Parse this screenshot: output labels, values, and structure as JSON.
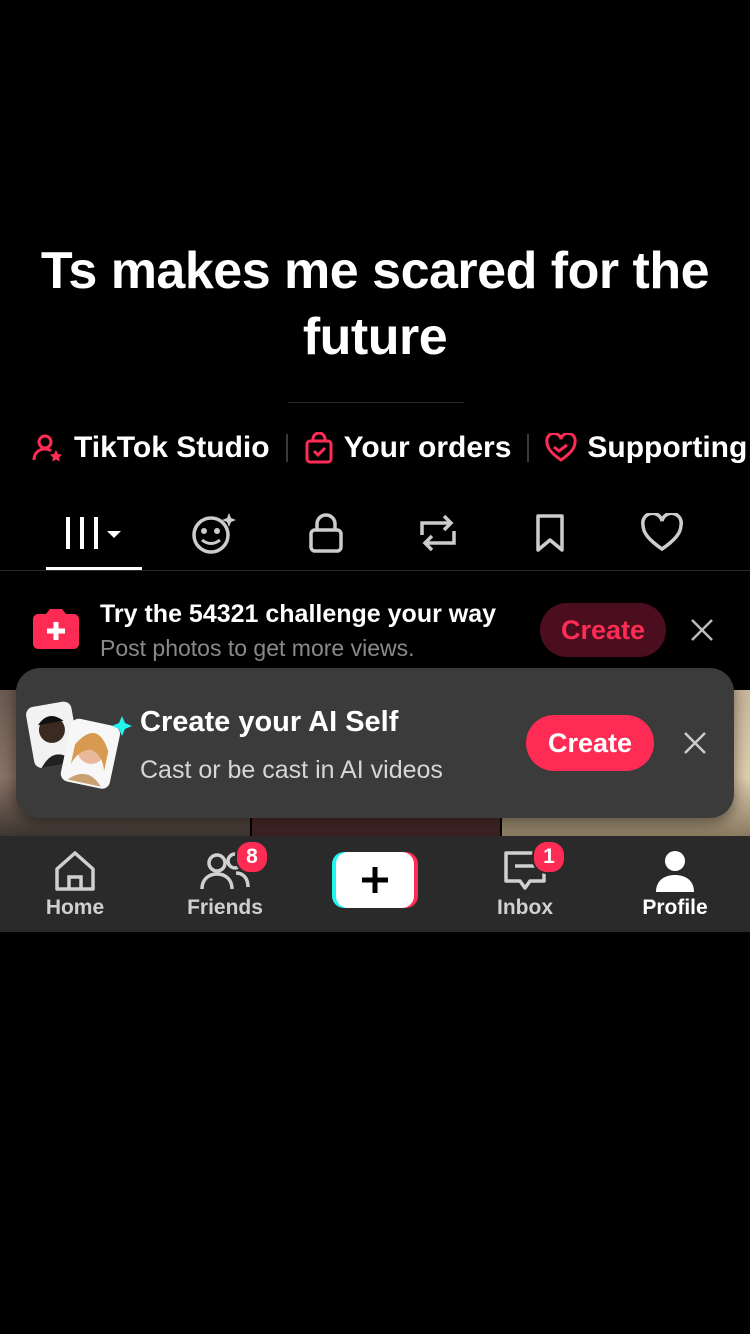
{
  "caption": "Ts makes me scared for the future",
  "quick_links": [
    {
      "label": "TikTok Studio",
      "icon": "person-star-icon"
    },
    {
      "label": "Your orders",
      "icon": "shopping-bag-icon"
    },
    {
      "label": "Supporting",
      "icon": "heart-hand-icon"
    }
  ],
  "tabs": [
    "videos-grid-icon",
    "ai-face-icon",
    "lock-icon",
    "repost-icon",
    "bookmark-icon",
    "heart-icon"
  ],
  "challenge": {
    "title": "Try the 54321 challenge your way",
    "subtitle": "Post photos to get more views.",
    "button": "Create"
  },
  "ai_self": {
    "title": "Create your AI Self",
    "subtitle": "Cast or be cast in AI videos",
    "button": "Create"
  },
  "nav": {
    "home": "Home",
    "friends": "Friends",
    "friends_badge": "8",
    "inbox": "Inbox",
    "inbox_badge": "1",
    "profile": "Profile"
  },
  "colors": {
    "accent": "#fe2c55",
    "cyan": "#25f4ee",
    "nav_bg": "#2a2a2a",
    "card_bg": "#3b3b3b"
  }
}
